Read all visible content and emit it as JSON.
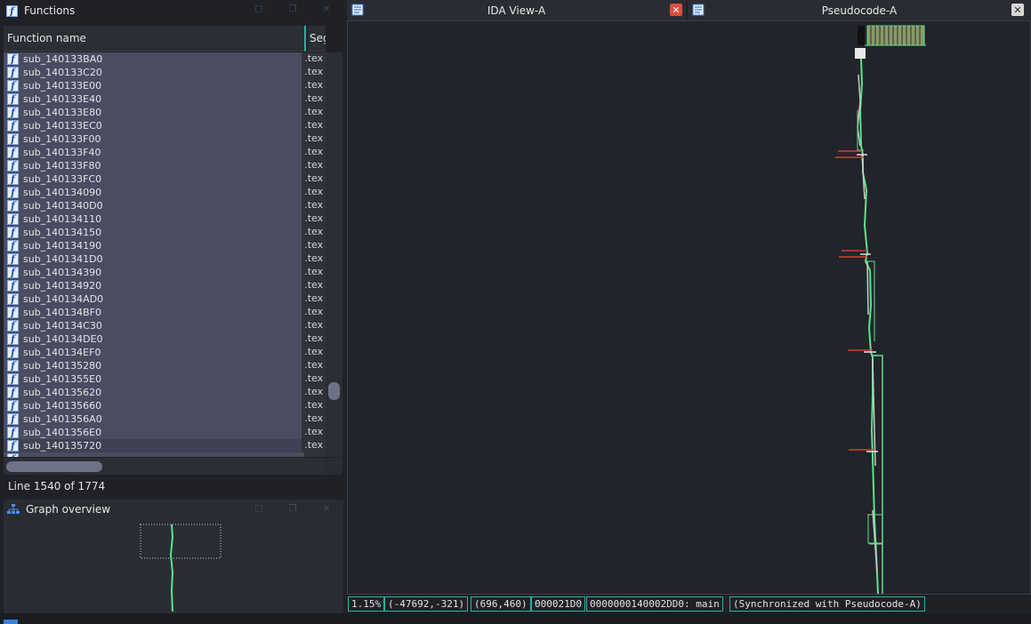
{
  "functions_panel": {
    "title": "Functions",
    "columns": [
      "Function name",
      "Seg"
    ],
    "rows": [
      {
        "name": "sub_140133BA0",
        "seg": ".tex"
      },
      {
        "name": "sub_140133C20",
        "seg": ".tex"
      },
      {
        "name": "sub_140133E00",
        "seg": ".tex"
      },
      {
        "name": "sub_140133E40",
        "seg": ".tex"
      },
      {
        "name": "sub_140133E80",
        "seg": ".tex"
      },
      {
        "name": "sub_140133EC0",
        "seg": ".tex"
      },
      {
        "name": "sub_140133F00",
        "seg": ".tex"
      },
      {
        "name": "sub_140133F40",
        "seg": ".tex"
      },
      {
        "name": "sub_140133F80",
        "seg": ".tex"
      },
      {
        "name": "sub_140133FC0",
        "seg": ".tex"
      },
      {
        "name": "sub_140134090",
        "seg": ".tex"
      },
      {
        "name": "sub_1401340D0",
        "seg": ".tex"
      },
      {
        "name": "sub_140134110",
        "seg": ".tex"
      },
      {
        "name": "sub_140134150",
        "seg": ".tex"
      },
      {
        "name": "sub_140134190",
        "seg": ".tex"
      },
      {
        "name": "sub_1401341D0",
        "seg": ".tex"
      },
      {
        "name": "sub_140134390",
        "seg": ".tex"
      },
      {
        "name": "sub_140134920",
        "seg": ".tex"
      },
      {
        "name": "sub_140134AD0",
        "seg": ".tex"
      },
      {
        "name": "sub_140134BF0",
        "seg": ".tex"
      },
      {
        "name": "sub_140134C30",
        "seg": ".tex"
      },
      {
        "name": "sub_140134DE0",
        "seg": ".tex"
      },
      {
        "name": "sub_140134EF0",
        "seg": ".tex"
      },
      {
        "name": "sub_140135280",
        "seg": ".tex"
      },
      {
        "name": "sub_1401355E0",
        "seg": ".tex"
      },
      {
        "name": "sub_140135620",
        "seg": ".tex"
      },
      {
        "name": "sub_140135660",
        "seg": ".tex"
      },
      {
        "name": "sub_1401356A0",
        "seg": ".tex"
      },
      {
        "name": "sub_1401356E0",
        "seg": ".tex"
      },
      {
        "name": "sub_140135720",
        "seg": ".tex"
      }
    ],
    "line_status": "Line 1540 of 1774"
  },
  "graph_overview": {
    "title": "Graph overview"
  },
  "tabs": {
    "ida_view": "IDA View-A",
    "pseudocode": "Pseudocode-A"
  },
  "statusbar": {
    "zoom": "1.15%",
    "coords": "(-47692,-321)",
    "mouse": "(696,460)",
    "offset": "000021D0",
    "location": "0000000140002DD0: main",
    "sync": "(Synchronized with Pseudocode-A)"
  },
  "colors": {
    "accent": "#28b3a0",
    "graph_edge": "#5fe08a",
    "close_red": "#e04b3c"
  }
}
